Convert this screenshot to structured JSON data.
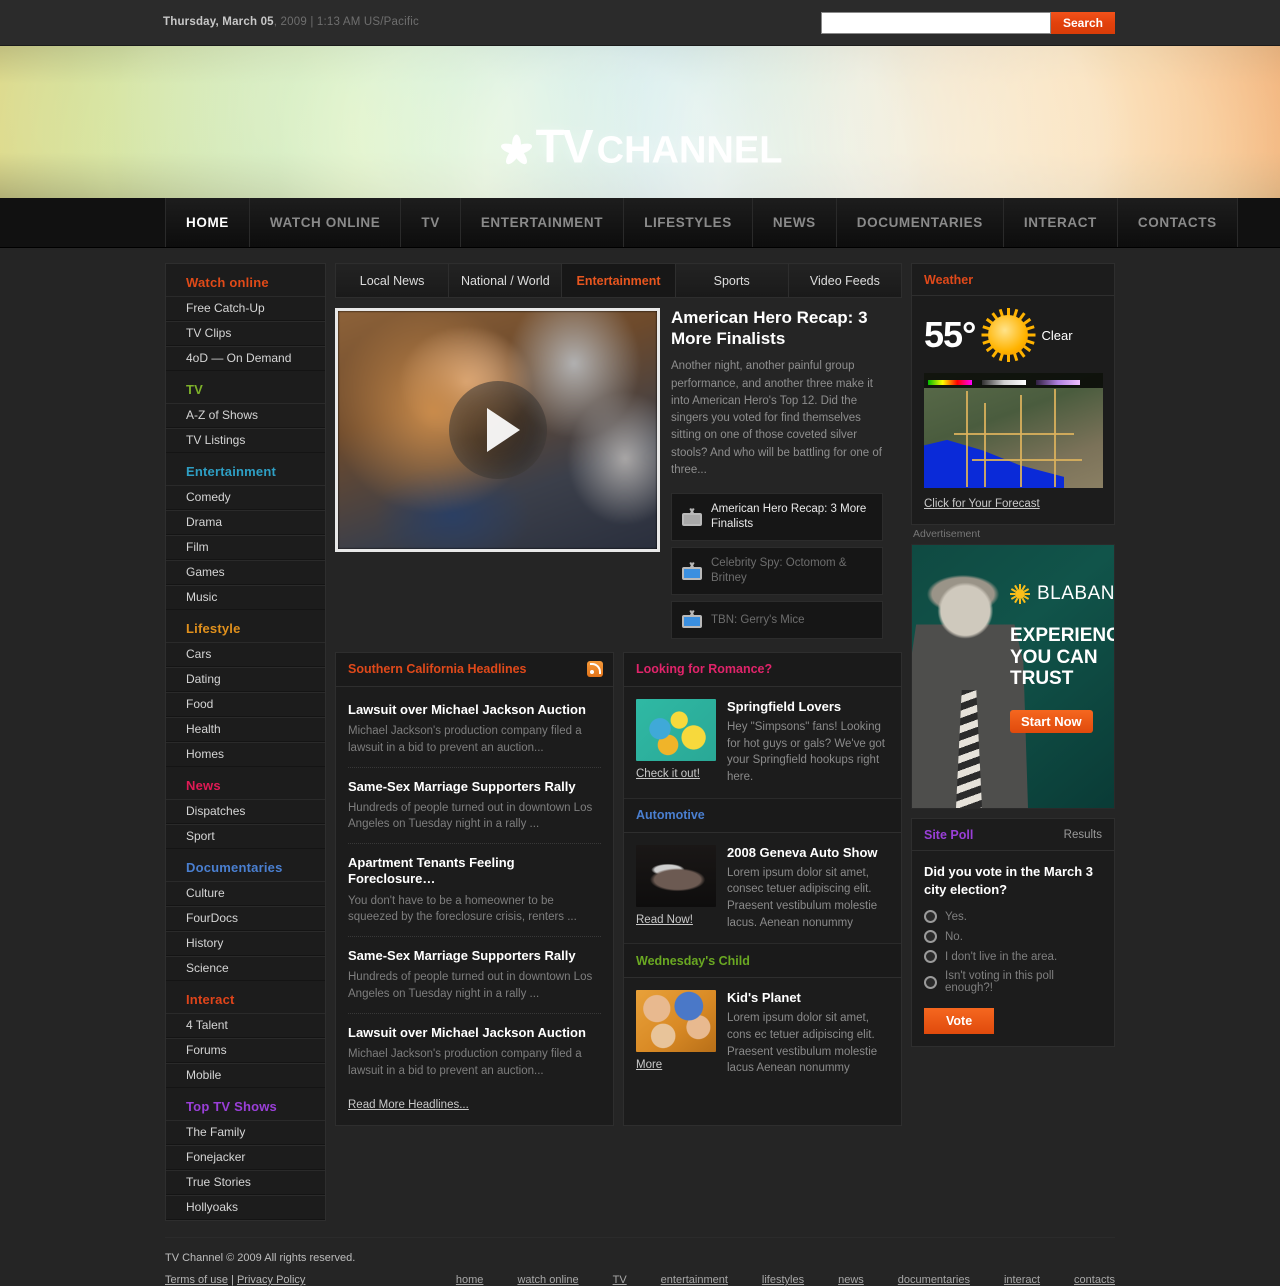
{
  "topbar": {
    "date_strong": "Thursday, March 05",
    "date_rest": ", 2009 | 1:13 AM US/Pacific",
    "search_placeholder": "",
    "search_value": "",
    "search_button": "Search"
  },
  "logo": {
    "tv": "TV",
    "channel": "CHANNEL"
  },
  "nav": [
    {
      "label": "HOME",
      "active": true
    },
    {
      "label": "WATCH ONLINE",
      "active": false
    },
    {
      "label": "TV",
      "active": false
    },
    {
      "label": "ENTERTAINMENT",
      "active": false
    },
    {
      "label": "LIFESTYLES",
      "active": false
    },
    {
      "label": "NEWS",
      "active": false
    },
    {
      "label": "DOCUMENTARIES",
      "active": false
    },
    {
      "label": "INTERACT",
      "active": false
    },
    {
      "label": "CONTACTS",
      "active": false
    }
  ],
  "sidebar": {
    "groups": [
      {
        "title": "Watch online",
        "color": "#e04a18",
        "items": [
          "Free Catch-Up",
          "TV Clips",
          "4oD — On Demand"
        ]
      },
      {
        "title": "TV",
        "color": "#7db02a",
        "items": [
          "A-Z of Shows",
          "TV Listings"
        ]
      },
      {
        "title": "Entertainment",
        "color": "#2e9fc4",
        "items": [
          "Comedy",
          "Drama",
          "Film",
          "Games",
          "Music"
        ]
      },
      {
        "title": "Lifestyle",
        "color": "#e0901c",
        "items": [
          "Cars",
          "Dating",
          "Food",
          "Health",
          "Homes"
        ]
      },
      {
        "title": "News",
        "color": "#e01a55",
        "items": [
          "Dispatches",
          "Sport"
        ]
      },
      {
        "title": "Documentaries",
        "color": "#4a7fd0",
        "items": [
          "Culture",
          "FourDocs",
          "History",
          "Science"
        ]
      },
      {
        "title": "Interact",
        "color": "#e0441a",
        "items": [
          "4 Talent",
          "Forums",
          "Mobile"
        ]
      },
      {
        "title": "Top TV Shows",
        "color": "#9a3fd8",
        "items": [
          "The Family",
          "Fonejacker",
          "True Stories",
          "Hollyoaks"
        ]
      }
    ]
  },
  "tabs": [
    {
      "label": "Local News",
      "active": false
    },
    {
      "label": "National / World",
      "active": false
    },
    {
      "label": "Entertainment",
      "active": true
    },
    {
      "label": "Sports",
      "active": false
    },
    {
      "label": "Video Feeds",
      "active": false
    }
  ],
  "feature": {
    "title": "American Hero Recap: 3 More Finalists",
    "description": "Another night, another painful group performance, and another three make it into American Hero's Top 12. Did the singers you voted for find themselves sitting on one of those coveted silver stools? And who will be battling for one of three...",
    "playlist": [
      {
        "label": "American Hero Recap: 3 More Finalists",
        "active": true
      },
      {
        "label": "Celebrity Spy: Octomom & Britney",
        "active": false
      },
      {
        "label": "TBN: Gerry's Mice",
        "active": false
      }
    ]
  },
  "headlines": {
    "title": "Southern California Headlines",
    "title_color": "#e0491a",
    "more_link": "Read More Headlines...",
    "items": [
      {
        "title": "Lawsuit over Michael Jackson Auction",
        "desc": "Michael Jackson's production company filed a lawsuit in a bid to prevent an auction..."
      },
      {
        "title": "Same-Sex Marriage Supporters Rally",
        "desc": "Hundreds of people turned out in downtown Los Angeles on Tuesday night in a rally ..."
      },
      {
        "title": "Apartment Tenants Feeling Foreclosure…",
        "desc": "You don't have to be a homeowner to be squeezed by the foreclosure crisis, renters ..."
      },
      {
        "title": "Same-Sex Marriage Supporters Rally",
        "desc": "Hundreds of people turned out in downtown Los Angeles on Tuesday night in a rally ..."
      },
      {
        "title": "Lawsuit over Michael Jackson Auction",
        "desc": "Michael Jackson's production company filed a lawsuit in a bid to prevent an auction..."
      }
    ]
  },
  "promos": [
    {
      "heading": "Looking for Romance?",
      "heading_color": "#e0246a",
      "title": "Springfield Lovers",
      "desc": "Hey \"Simpsons\" fans! Looking for hot guys or gals? We've got your Springfield hookups right here.",
      "link": "Check it out!",
      "image": "simpsons-thumbnail"
    },
    {
      "heading": "Automotive",
      "heading_color": "#4a7fd0",
      "title": "2008 Geneva Auto Show",
      "desc": "Lorem ipsum dolor sit amet, consec tetuer adipiscing elit. Praesent vestibulum molestie lacus. Aenean nonummy",
      "link": "Read Now!",
      "image": "car-thumbnail"
    },
    {
      "heading": "Wednesday's Child",
      "heading_color": "#6aa822",
      "title": "Kid's Planet",
      "desc": "Lorem ipsum dolor sit amet, cons ec tetuer adipiscing elit. Praesent vestibulum molestie lacus Aenean nonummy",
      "link": "More",
      "image": "kids-thumbnail"
    }
  ],
  "weather": {
    "title": "Weather",
    "title_color": "#e0491a",
    "temperature": "55°",
    "condition": "Clear",
    "map_alt": "los-angeles-radar-map",
    "forecast_link": "Click for Your Forecast"
  },
  "ad": {
    "label": "Advertisement",
    "brand": "BLABANK",
    "headline": "EXPERIENCE YOU CAN TRUST",
    "button": "Start Now"
  },
  "poll": {
    "title": "Site Poll",
    "title_color": "#9a3fd8",
    "results_link": "Results",
    "question": "Did you vote in the March 3 city election?",
    "options": [
      "Yes.",
      "No.",
      "I don't live in the area.",
      "Isn't voting in this poll enough?!"
    ],
    "vote_button": "Vote"
  },
  "footer": {
    "copyright": "TV Channel © 2009 All rights reserved.",
    "terms": "Terms of use",
    "separator": "|",
    "privacy": "Privacy Policy",
    "links": [
      "home",
      "watch online",
      "TV",
      "entertainment",
      "lifestyles",
      "news",
      "documentaries",
      "interact",
      "contacts"
    ]
  }
}
